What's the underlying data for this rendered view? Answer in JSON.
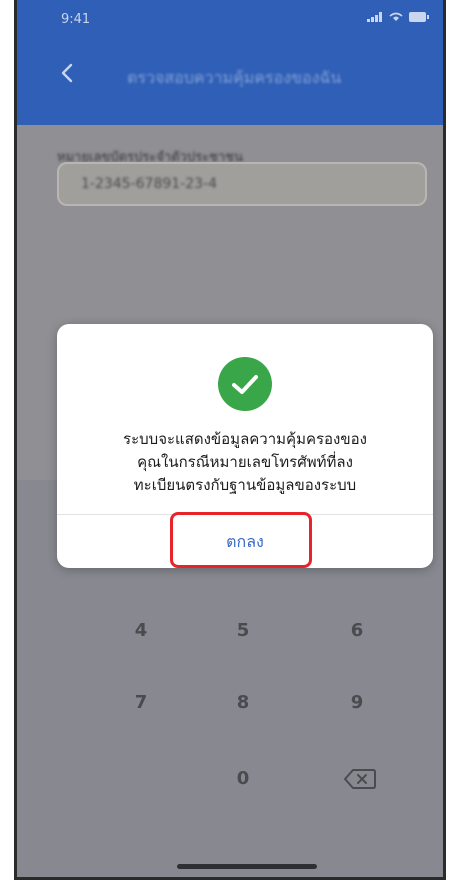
{
  "status_bar": {
    "time": "9:41"
  },
  "header": {
    "title": "ตรวจสอบความคุ้มครองของฉัน"
  },
  "form": {
    "label": "หมายเลขบัตรประจำตัวประชาชน",
    "id_value": "1-2345-67891-23-4"
  },
  "dialog": {
    "icon": "check-circle-icon",
    "message_line1": "ระบบจะแสดงข้อมูลความคุ้มครองของ",
    "message_line2": "คุณในกรณีหมายเลขโทรศัพท์ที่ลง",
    "message_line3": "ทะเบียนตรงกับฐานข้อมูลของระบบ",
    "ok_label": "ตกลง"
  },
  "keypad": {
    "keys_row1": [
      "4",
      "5",
      "6"
    ],
    "keys_row2": [
      "7",
      "8",
      "9"
    ],
    "keys_row3": [
      "0"
    ]
  },
  "colors": {
    "header": "#2f5fb6",
    "accent": "#3a68c9",
    "success": "#3aa64a",
    "highlight": "#e8242a"
  }
}
